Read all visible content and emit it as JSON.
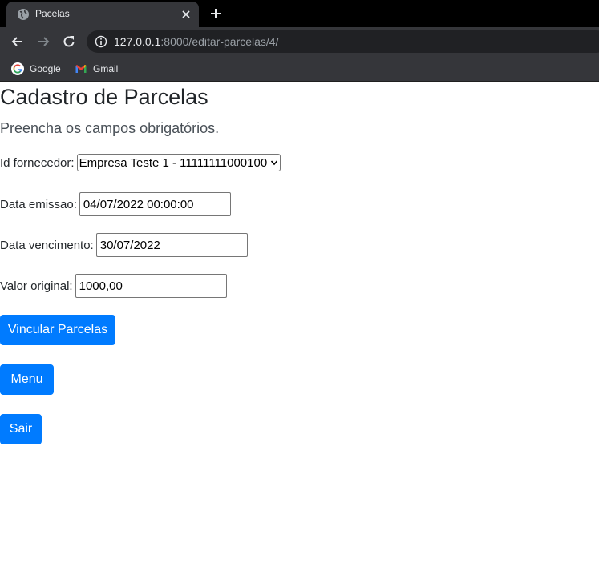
{
  "browser": {
    "tab_title": "Pacelas",
    "url_host": "127.0.0.1",
    "url_rest": ":8000/editar-parcelas/4/",
    "bookmarks": [
      {
        "label": "Google",
        "icon": "google-icon"
      },
      {
        "label": "Gmail",
        "icon": "gmail-icon"
      }
    ],
    "colors": {
      "tabstrip": "#000000",
      "toolbar": "#35363a",
      "omnibox": "#202124"
    }
  },
  "page": {
    "title": "Cadastro de Parcelas",
    "subtitle": "Preencha os campos obrigatórios.",
    "fields": {
      "fornecedor": {
        "label": "Id fornecedor:",
        "selected": "Empresa Teste 1 - 11111111000100"
      },
      "emissao": {
        "label": "Data emissao:",
        "value": "04/07/2022 00:00:00"
      },
      "vencimento": {
        "label": "Data vencimento:",
        "value": "30/07/2022"
      },
      "valor": {
        "label": "Valor original:",
        "value": "1000,00"
      }
    },
    "buttons": {
      "vincular": "Vincular Parcelas",
      "menu": "Menu",
      "sair": "Sair"
    },
    "colors": {
      "primary": "#007bff"
    }
  }
}
